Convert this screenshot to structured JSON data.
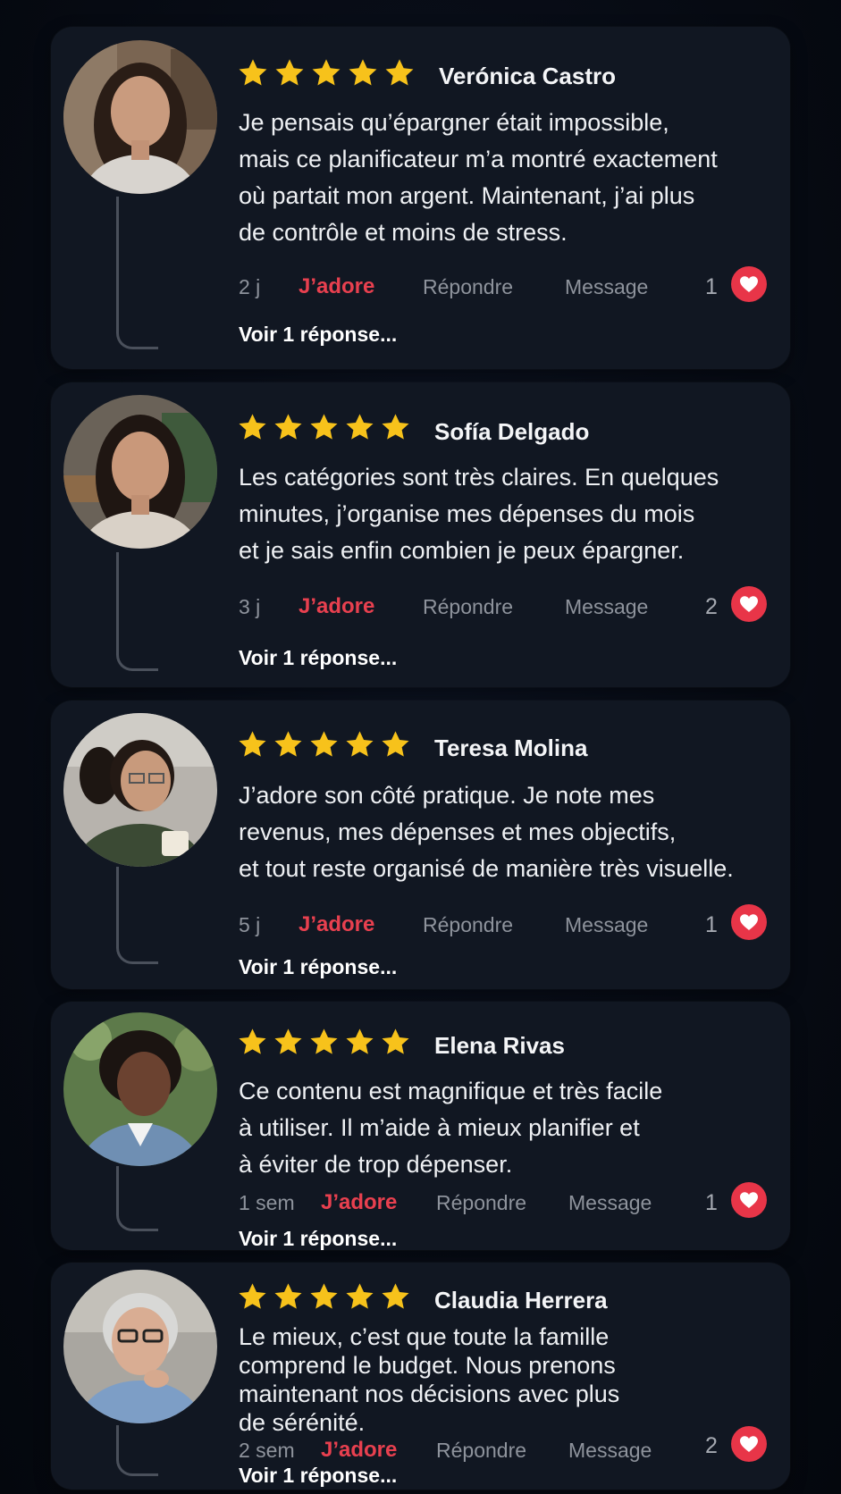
{
  "colors": {
    "background": "#060a12",
    "card": "#111722",
    "star": "#f7c21b",
    "accent": "#e8404f",
    "heart_badge": "#e83548",
    "muted_text": "#8e939c"
  },
  "icons": {
    "star": "star-icon",
    "heart": "heart-icon",
    "thread": "thread-line"
  },
  "reviews": [
    {
      "name": "Verónica Castro",
      "rating": 5,
      "text": "Je pensais qu’épargner était impossible,\nmais ce planificateur m’a montré exactement\noù partait mon argent. Maintenant, j’ai plus\nde contrôle et moins de stress.",
      "time": "2 j",
      "love_label": "J’adore",
      "reply_label": "Répondre",
      "message_label": "Message",
      "likes": "1",
      "replies_label": "Voir 1 réponse..."
    },
    {
      "name": "Sofía Delgado",
      "rating": 5,
      "text": "Les catégories sont très claires. En quelques\nminutes, j’organise mes dépenses du mois\net je sais enfin combien je peux épargner.",
      "time": "3 j",
      "love_label": "J’adore",
      "reply_label": "Répondre",
      "message_label": "Message",
      "likes": "2",
      "replies_label": "Voir 1 réponse..."
    },
    {
      "name": "Teresa Molina",
      "rating": 5,
      "text": "J’adore son côté pratique. Je note mes\nrevenus, mes dépenses et mes objectifs,\net tout reste organisé de manière très visuelle.",
      "time": "5 j",
      "love_label": "J’adore",
      "reply_label": "Répondre",
      "message_label": "Message",
      "likes": "1",
      "replies_label": "Voir 1 réponse..."
    },
    {
      "name": "Elena Rivas",
      "rating": 5,
      "text": "Ce contenu est magnifique et très facile\nà utiliser. Il m’aide à mieux planifier et\nà éviter de trop dépenser.",
      "time": "1 sem",
      "love_label": "J’adore",
      "reply_label": "Répondre",
      "message_label": "Message",
      "likes": "1",
      "replies_label": "Voir 1 réponse..."
    },
    {
      "name": "Claudia Herrera",
      "rating": 5,
      "text": "Le mieux, c’est que toute la famille\ncomprend le budget. Nous prenons\nmaintenant nos décisions avec plus\nde sérénité.",
      "time": "2 sem",
      "love_label": "J’adore",
      "reply_label": "Répondre",
      "message_label": "Message",
      "likes": "2",
      "replies_label": "Voir 1 réponse..."
    }
  ]
}
